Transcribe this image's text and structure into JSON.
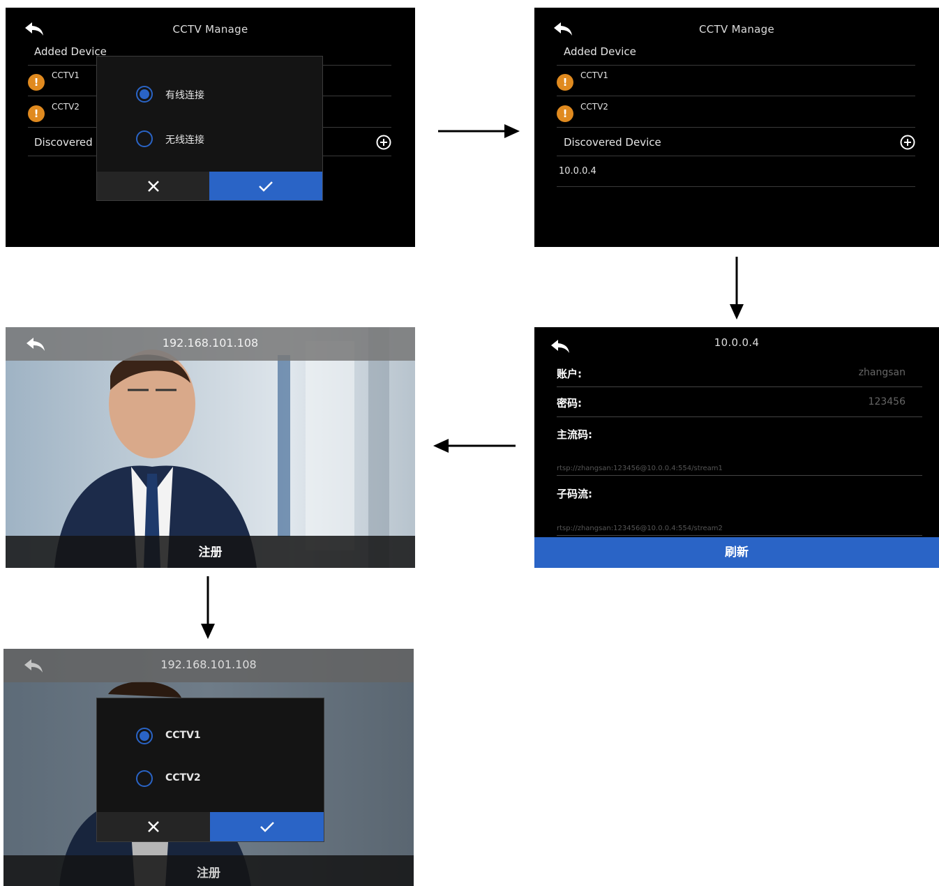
{
  "colors": {
    "accent": "#2a64c6",
    "warning": "#e08a1f"
  },
  "screen1": {
    "title": "CCTV Manage",
    "added_label": "Added Device",
    "devices": [
      {
        "name": "CCTV1",
        "icon": "warning-icon"
      },
      {
        "name": "CCTV2",
        "icon": "warning-icon"
      }
    ],
    "discovered_label": "Discovered",
    "dialog": {
      "options": [
        {
          "label": "有线连接",
          "selected": true
        },
        {
          "label": "无线连接",
          "selected": false
        }
      ],
      "cancel_icon": "close-icon",
      "confirm_icon": "check-icon"
    }
  },
  "screen2": {
    "title": "CCTV Manage",
    "added_label": "Added Device",
    "devices": [
      {
        "name": "CCTV1",
        "icon": "warning-icon"
      },
      {
        "name": "CCTV2",
        "icon": "warning-icon"
      }
    ],
    "discovered_label": "Discovered Device",
    "discovered_items": [
      "10.0.0.4"
    ]
  },
  "screen3": {
    "title": "10.0.0.4",
    "account_label": "账户:",
    "account_value": "zhangsan",
    "password_label": "密码:",
    "password_value": "123456",
    "main_stream_label": "主流码:",
    "main_stream_url": "rtsp://zhangsan:123456@10.0.0.4:554/stream1",
    "sub_stream_label": "子码流:",
    "sub_stream_url": "rtsp://zhangsan:123456@10.0.0.4:554/stream2",
    "refresh_label": "刷新"
  },
  "screen4": {
    "title": "192.168.101.108",
    "register_label": "注册"
  },
  "screen5": {
    "title": "192.168.101.108",
    "register_label": "注册",
    "dialog": {
      "options": [
        {
          "label": "CCTV1",
          "selected": true
        },
        {
          "label": "CCTV2",
          "selected": false
        }
      ],
      "cancel_icon": "close-icon",
      "confirm_icon": "check-icon"
    }
  }
}
